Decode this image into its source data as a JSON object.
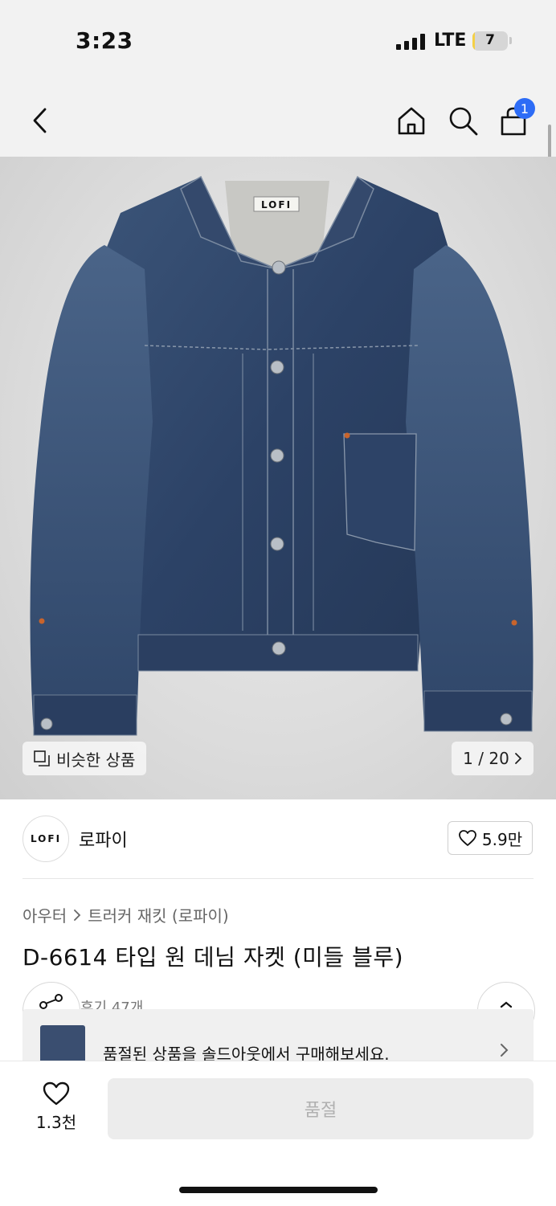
{
  "status_bar": {
    "time": "3:23",
    "network": "LTE",
    "battery": "7",
    "battery_level": 0.07
  },
  "header": {
    "cart_badge": "1"
  },
  "image": {
    "similar_label": "비슷한 상품",
    "page_counter": "1 / 20",
    "brand_label_on_jacket": "LOFI"
  },
  "brand": {
    "logo_text": "LOFI",
    "name": "로파이",
    "likes": "5.9만"
  },
  "breadcrumb": {
    "category": "아우터",
    "subcategory": "트러커 재킷 (로파이)"
  },
  "product": {
    "title": "D-6614 타입 원 데님 자켓 (미들 블루)",
    "reviews": "후기 47개"
  },
  "soldout_banner": {
    "text": "품절된 상품을 솔드아웃에서 구매해보세요."
  },
  "bottom_bar": {
    "wish_count": "1.3천",
    "buy_label": "품절"
  },
  "colors": {
    "accent": "#2d6cf6",
    "denim": "#2f4566"
  }
}
